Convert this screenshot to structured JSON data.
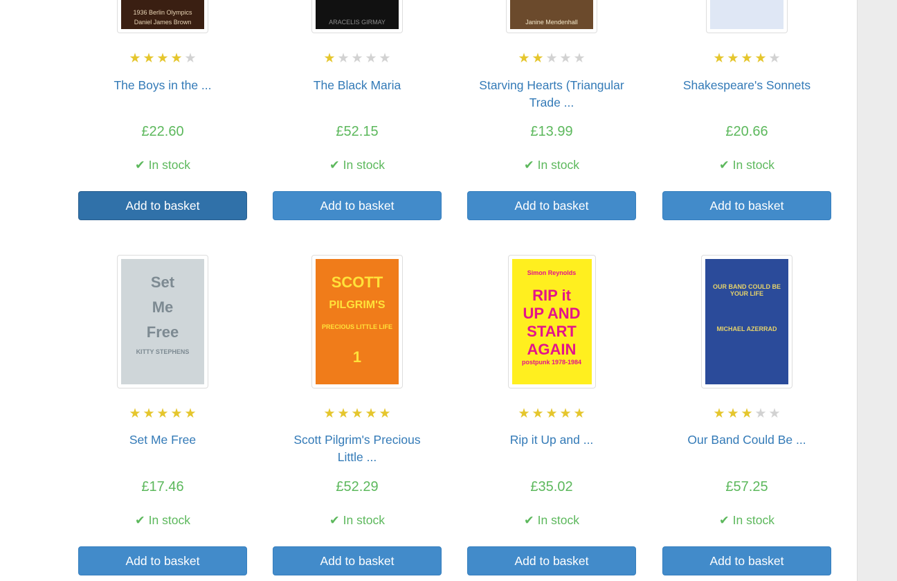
{
  "colors": {
    "link": "#337ab7",
    "price": "#5cb85c",
    "star_on": "#e5c62d",
    "star_off": "#d2d2d2",
    "button": "#428bca"
  },
  "rows": [
    {
      "books": [
        {
          "title": "The Boys in the ...",
          "price": "£22.60",
          "rating": 4,
          "stock": "In stock",
          "button": "Add to basket",
          "cover": {
            "lines": [
              "1936 Berlin Olympics",
              "Daniel James Brown"
            ],
            "bg": "#3a1f12",
            "fg": "#e8d4b5"
          }
        },
        {
          "title": "The Black Maria",
          "price": "£52.15",
          "rating": 1,
          "stock": "In stock",
          "button": "Add to basket",
          "cover": {
            "lines": [
              "ARACELIS GIRMAY"
            ],
            "bg": "#111111",
            "fg": "#8c8c8c"
          }
        },
        {
          "title": "Starving Hearts (Triangular Trade ...",
          "price": "£13.99",
          "rating": 2,
          "stock": "In stock",
          "button": "Add to basket",
          "cover": {
            "lines": [
              "Janine Mendenhall"
            ],
            "bg": "#6b4a2c",
            "fg": "#f2e6c8"
          }
        },
        {
          "title": "Shakespeare's Sonnets",
          "price": "£20.66",
          "rating": 4,
          "stock": "In stock",
          "button": "Add to basket",
          "cover": {
            "lines": [],
            "bg": "#dfe7f5",
            "fg": "#2a4b8d"
          }
        }
      ]
    },
    {
      "books": [
        {
          "title": "Set Me Free",
          "price": "£17.46",
          "rating": 5,
          "stock": "In stock",
          "button": "Add to basket",
          "cover": {
            "lines": [
              "Set",
              "Me",
              "Free",
              "KITTY STEPHENS"
            ],
            "bg": "#cfd6d9",
            "fg": "#7d8a92"
          }
        },
        {
          "title": "Scott Pilgrim's Precious Little ...",
          "price": "£52.29",
          "rating": 5,
          "stock": "In stock",
          "button": "Add to basket",
          "cover": {
            "lines": [
              "SCOTT",
              "PILGRIM'S",
              "PRECIOUS LITTLE LIFE",
              "1"
            ],
            "bg": "#f07c1a",
            "fg": "#ffe23a"
          }
        },
        {
          "title": "Rip it Up and ...",
          "price": "£35.02",
          "rating": 5,
          "stock": "In stock",
          "button": "Add to basket",
          "cover": {
            "lines": [
              "Simon Reynolds",
              "RIP it",
              "UP AND",
              "START",
              "AGAIN",
              "postpunk 1978-1984"
            ],
            "bg": "#ffef1f",
            "fg": "#e3148a"
          }
        },
        {
          "title": "Our Band Could Be ...",
          "price": "£57.25",
          "rating": 3,
          "stock": "In stock",
          "button": "Add to basket",
          "cover": {
            "lines": [
              "OUR BAND COULD BE YOUR LIFE",
              "MICHAEL AZERRAD"
            ],
            "bg": "#2b4b9a",
            "fg": "#e6d36a"
          }
        }
      ]
    }
  ]
}
